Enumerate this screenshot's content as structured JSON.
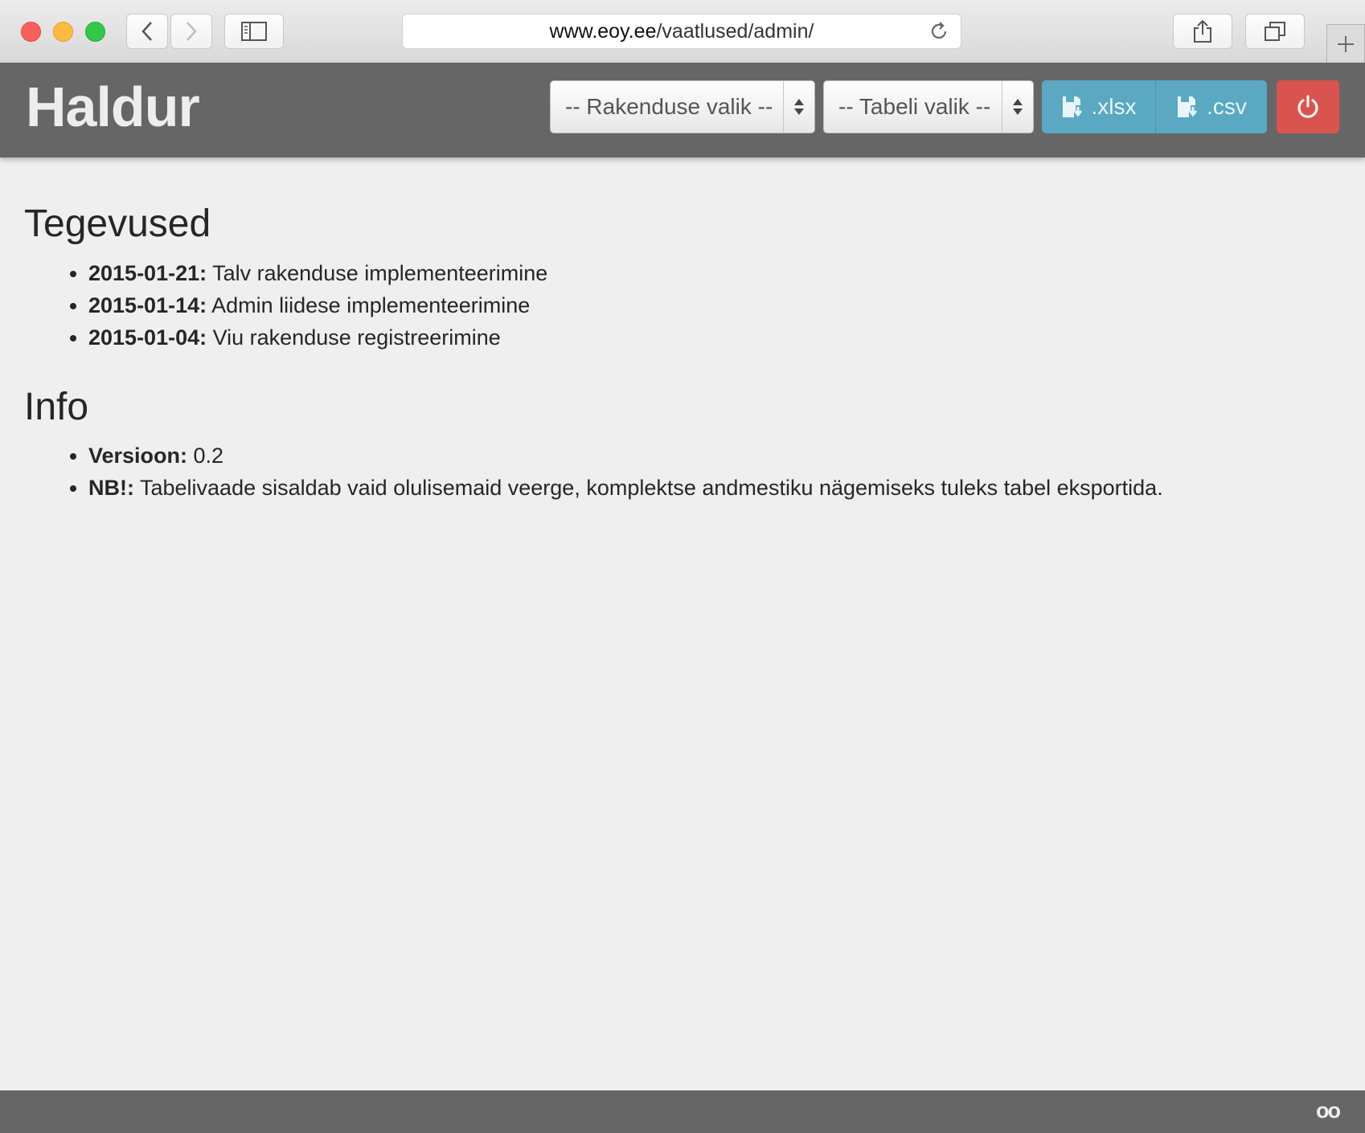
{
  "browser": {
    "url_domain": "www.eoy.ee",
    "url_path": "/vaatlused/admin/"
  },
  "header": {
    "title": "Haldur",
    "app_select_placeholder": "-- Rakenduse valik --",
    "table_select_placeholder": "-- Tabeli valik --",
    "export_xlsx_label": ".xlsx",
    "export_csv_label": ".csv"
  },
  "activities": {
    "heading": "Tegevused",
    "items": [
      {
        "date": "2015-01-21:",
        "text": " Talv rakenduse implementeerimine"
      },
      {
        "date": "2015-01-14:",
        "text": " Admin liidese implementeerimine"
      },
      {
        "date": "2015-01-04:",
        "text": " Viu rakenduse registreerimine"
      }
    ]
  },
  "info": {
    "heading": "Info",
    "items": [
      {
        "label": "Versioon:",
        "text": " 0.2"
      },
      {
        "label": "NB!:",
        "text": " Tabelivaade sisaldab vaid olulisemaid veerge, komplektse andmestiku nägemiseks tuleks tabel eksportida."
      }
    ]
  },
  "footer": {
    "mark": "oo"
  },
  "colors": {
    "header_bg": "#666666",
    "export_button": "#5aa8c2",
    "logout_button": "#d9534f",
    "page_bg": "#efefef"
  },
  "icons": {
    "export": "floppy-disk-icon",
    "logout": "power-icon"
  }
}
